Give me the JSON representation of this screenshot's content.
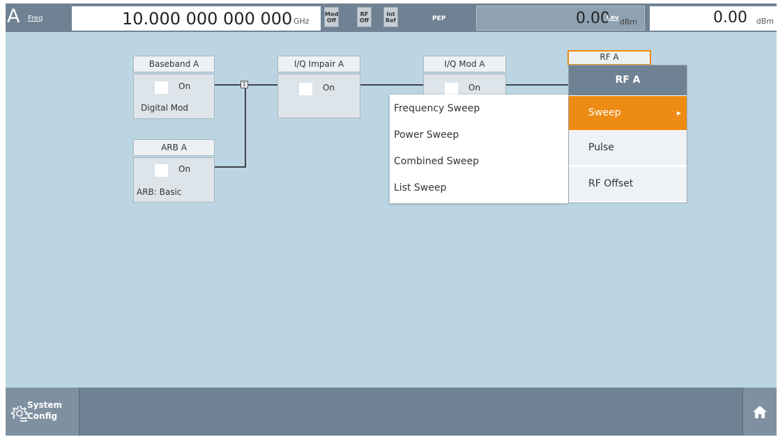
{
  "header": {
    "channel": "A",
    "freq_label": "Freq",
    "freq_value": "10.000 000 000 000",
    "freq_unit": "GHz",
    "status_buttons": [
      {
        "top": "Mod",
        "bottom": "Off"
      },
      {
        "top": "RF",
        "bottom": "Off"
      },
      {
        "top": "Int",
        "bottom": "Ref"
      }
    ],
    "pep_label": "PEP",
    "pep_value": "0.00",
    "pep_unit": "dBm",
    "lev_label": "Lev",
    "lev_value": "0.00",
    "lev_unit": "dBm"
  },
  "blocks": {
    "baseband": {
      "title": "Baseband A",
      "on_label": "On",
      "sub": "Digital Mod"
    },
    "arb": {
      "title": "ARB A",
      "on_label": "On",
      "sub": "ARB: Basic"
    },
    "iq_impair": {
      "title": "I/Q Impair A",
      "on_label": "On"
    },
    "iq_mod": {
      "title": "I/Q Mod A",
      "on_label": "On"
    },
    "rf": {
      "title": "RF A"
    },
    "sum_symbol": "Σ"
  },
  "menu": {
    "title": "RF A",
    "items": [
      {
        "label": "Sweep",
        "active": true,
        "arrow": "▶"
      },
      {
        "label": "Pulse",
        "active": false
      },
      {
        "label": "RF Offset",
        "active": false
      }
    ],
    "submenu": [
      "Frequency Sweep",
      "Power Sweep",
      "Combined Sweep",
      "List Sweep"
    ]
  },
  "footer": {
    "system_config_line1": "System",
    "system_config_line2": "Config"
  },
  "colors": {
    "background": "#bcd5e2",
    "bar": "#6f8293",
    "accent": "#ee8b14"
  }
}
